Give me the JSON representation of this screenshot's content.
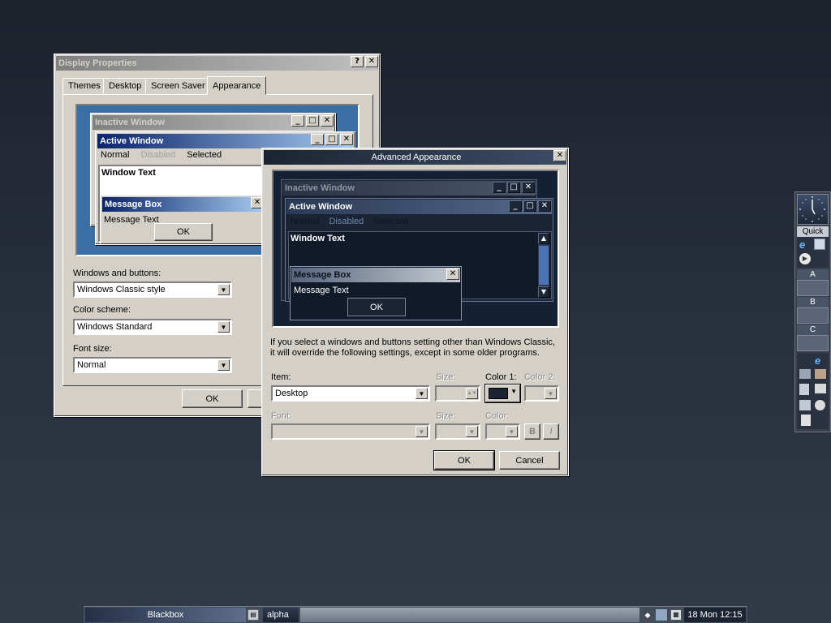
{
  "display_properties": {
    "title": "Display Properties",
    "help": "?",
    "close": "✕",
    "tabs": [
      "Themes",
      "Desktop",
      "Screen Saver",
      "Appearance"
    ],
    "preview": {
      "inactive_title": "Inactive Window",
      "active_title": "Active Window",
      "menu_normal": "Normal",
      "menu_disabled": "Disabled",
      "menu_selected": "Selected",
      "window_text": "Window Text",
      "msgbox_title": "Message Box",
      "msgbox_text": "Message Text",
      "ok": "OK"
    },
    "windows_buttons_label": "Windows and buttons:",
    "windows_buttons_value": "Windows Classic style",
    "color_scheme_label": "Color scheme:",
    "color_scheme_value": "Windows Standard",
    "font_size_label": "Font size:",
    "font_size_value": "Normal",
    "ok": "OK"
  },
  "advanced": {
    "title": "Advanced Appearance",
    "close": "✕",
    "preview": {
      "inactive_title": "Inactive Window",
      "active_title": "Active Window",
      "menu_normal": "Normal",
      "menu_disabled": "Disabled",
      "menu_selected": "Selected",
      "window_text": "Window Text",
      "msgbox_title": "Message Box",
      "msgbox_text": "Message Text",
      "ok": "OK"
    },
    "info_line1": "If you select a windows and buttons setting other than Windows Classic,",
    "info_line2": "it will override the following settings, except in some older programs.",
    "item_label": "Item:",
    "item_value": "Desktop",
    "size_label": "Size:",
    "color1_label": "Color 1:",
    "color2_label": "Color 2:",
    "font_label": "Font:",
    "font_size_label": "Size:",
    "font_color_label": "Color:",
    "bold": "B",
    "italic": "I",
    "ok": "OK",
    "cancel": "Cancel",
    "color1": "#1c2433"
  },
  "slit": {
    "quick_label": "Quick",
    "a": "A",
    "b": "B",
    "c": "C"
  },
  "taskbar": {
    "workspace": "Blackbox",
    "task": "alpha",
    "clock": "18 Mon 12:15"
  }
}
